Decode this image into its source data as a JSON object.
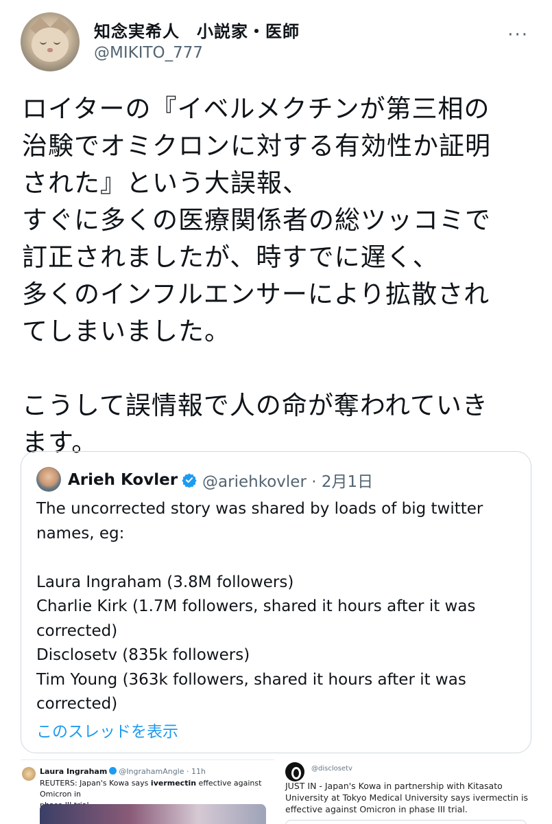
{
  "author": {
    "display_name": "知念実希人　小説家・医師",
    "handle": "@MIKITO_777"
  },
  "tweet": {
    "text": "ロイターの『イベルメクチンが第三相の\n治験でオミクロンに対する有効性か証明\nされた』という大誤報、\nすぐに多くの医療関係者の総ツッコミで\n訂正されましたが、時すでに遅く、\n多くのインフルエンサーにより拡散され\nてしまいました。\n\nこうして誤情報で人の命が奪われていき\nます。"
  },
  "quote": {
    "name": "Arieh Kovler",
    "handle_date": "@ariehkovler · 2月1日",
    "text": "The uncorrected story was shared by loads of big twitter\nnames, eg:\n\nLaura Ingraham (3.8M followers)\nCharlie Kirk (1.7M followers, shared it hours after it was\ncorrected)\nDisclosetv (835k followers)\nTim Young (363k followers, shared it hours after it was\ncorrected)",
    "show_thread": "このスレッドを表示"
  },
  "media_left": {
    "name": "Laura Ingraham",
    "handle_time": "@IngrahamAngle · 11h",
    "text_prefix": "REUTERS: Japan's Kowa says ",
    "text_bold": "ivermectin",
    "text_suffix": " effective against Omicron in\nphase III trial"
  },
  "media_right": {
    "handle": "@disclosetv",
    "text": "JUST IN - Japan's Kowa in partnership with Kitasato University at Tokyo Medical University says ivermectin is effective against Omicron in phase III trial."
  },
  "icons": {
    "more": "more-horizontal-icon",
    "verified": "verified-badge-icon"
  },
  "colors": {
    "link": "#1d9bf0",
    "secondary_text": "#536471",
    "border": "#cfd9de"
  }
}
